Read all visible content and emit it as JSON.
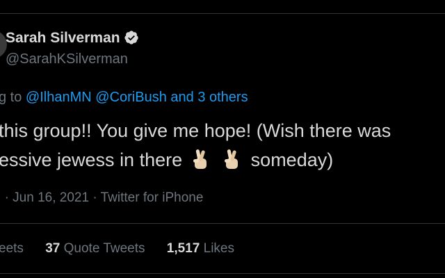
{
  "author": {
    "display_name": "Sarah Silverman",
    "handle": "@SarahKSilverman",
    "verified_icon": "verified-badge-icon"
  },
  "reply": {
    "prefix": "g to ",
    "mention_1": "@IlhanMN",
    "mention_2": "@CoriBush",
    "others": "and 3 others"
  },
  "tweet": {
    "line1": "this group!! You give me hope! (Wish there was",
    "line2_start": "essive jewess in there",
    "line2_end": "someday)",
    "emoji": "crossed-fingers-icon"
  },
  "meta": {
    "time_fragment": "I",
    "date": "Jun 16, 2021",
    "source": "Twitter for iPhone",
    "separator": "·"
  },
  "stats": {
    "retweets_fragment": "eets",
    "quote_count": "37",
    "quote_label": "Quote Tweets",
    "likes_count": "1,517",
    "likes_label": "Likes"
  },
  "colors": {
    "background": "#000000",
    "text": "#d9d9d9",
    "muted": "#6e767d",
    "link": "#1d9bf0",
    "divider": "#2f3336"
  }
}
